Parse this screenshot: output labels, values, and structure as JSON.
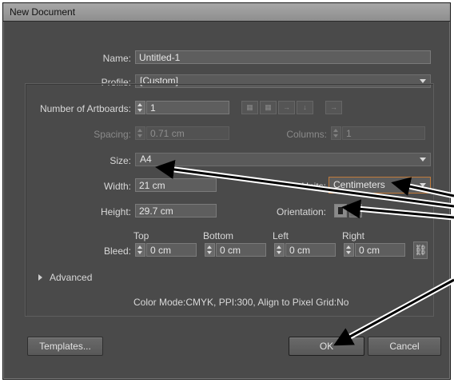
{
  "window": {
    "title": "New Document"
  },
  "form": {
    "name_label": "Name:",
    "name_value": "Untitled-1",
    "profile_label": "Profile:",
    "profile_value": "[Custom]",
    "artboards_label": "Number of Artboards:",
    "artboards_value": "1",
    "spacing_label": "Spacing:",
    "spacing_value": "0.71 cm",
    "columns_label": "Columns:",
    "columns_value": "1",
    "size_label": "Size:",
    "size_value": "A4",
    "width_label": "Width:",
    "width_value": "21 cm",
    "units_label": "Units:",
    "units_value": "Centimeters",
    "height_label": "Height:",
    "height_value": "29.7 cm",
    "orientation_label": "Orientation:",
    "bleed_label": "Bleed:",
    "bleed": {
      "top_label": "Top",
      "top_value": "0 cm",
      "bottom_label": "Bottom",
      "bottom_value": "0 cm",
      "left_label": "Left",
      "left_value": "0 cm",
      "right_label": "Right",
      "right_value": "0 cm"
    },
    "advanced_label": "Advanced",
    "summary": "Color Mode:CMYK, PPI:300, Align to Pixel Grid:No"
  },
  "buttons": {
    "templates": "Templates...",
    "ok": "OK",
    "cancel": "Cancel"
  },
  "icons": {
    "arrange_icons": [
      "grid-by-row-icon",
      "grid-by-column-icon",
      "arrange-by-row-icon",
      "arrange-by-column-icon",
      "change-layout-icon"
    ],
    "link_icon": "chain-link-icon",
    "orientation": [
      "portrait-icon",
      "landscape-icon"
    ]
  },
  "colors": {
    "dialog_bg": "#4a4a4a",
    "units_highlight": "#c07a3a",
    "annotation_arrow": "#000000"
  }
}
